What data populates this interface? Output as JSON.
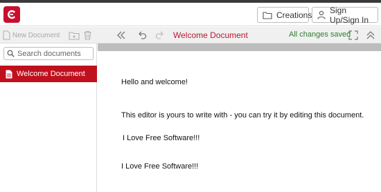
{
  "header": {
    "creations_label": "Creations",
    "signin_label": "Sign Up/Sign In"
  },
  "toolbar": {
    "new_document_label": "New Document",
    "document_title": "Welcome Document",
    "save_status": "All changes saved"
  },
  "sidebar": {
    "search_placeholder": "Search documents",
    "documents": [
      {
        "label": "Welcome Document",
        "selected": true
      }
    ]
  },
  "editor": {
    "lines": [
      "Hello and welcome!",
      "This editor is yours to write with - you can try it by editing this document.",
      "I Love Free Software!!!",
      "I Love Free Software!!!"
    ]
  },
  "colors": {
    "brand": "#c8102e",
    "selected_item": "#c0101e",
    "saved_status": "#2e7d32"
  },
  "icons": [
    "logo-icon",
    "folder-icon",
    "user-icon",
    "new-document-icon",
    "new-folder-icon",
    "trash-icon",
    "collapse-sidebar-icon",
    "undo-icon",
    "redo-icon",
    "fullscreen-icon",
    "collapse-toolbar-icon",
    "search-icon",
    "document-icon"
  ]
}
